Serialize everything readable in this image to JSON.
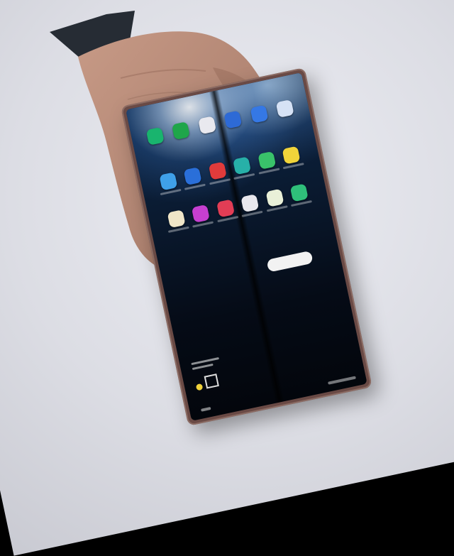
{
  "scene": {
    "background_color": "#dcdde4",
    "phone_frame_color": "#6a4a45"
  },
  "dock_icons": [
    {
      "name": "green-app-icon",
      "color": "#19b46e"
    },
    {
      "name": "green-app-icon-2",
      "color": "#1fa64a"
    },
    {
      "name": "gmail-icon",
      "color": "#e9e9ef"
    },
    {
      "name": "blue-app-icon",
      "color": "#2d6ad6"
    },
    {
      "name": "blue-app-icon-2",
      "color": "#3578e5"
    },
    {
      "name": "white-app-icon",
      "color": "#d6e2f5"
    }
  ],
  "home_icons": [
    {
      "name": "app-icon-1",
      "color": "#3fa0e8"
    },
    {
      "name": "app-icon-2",
      "color": "#2a6fd9"
    },
    {
      "name": "app-icon-3",
      "color": "#e03b3b"
    },
    {
      "name": "app-icon-4",
      "color": "#27b0a8"
    },
    {
      "name": "app-icon-5",
      "color": "#39c26a"
    },
    {
      "name": "app-icon-6",
      "color": "#f1d43a"
    },
    {
      "name": "app-icon-7",
      "color": "#f0e6c8"
    },
    {
      "name": "app-icon-8",
      "color": "#c63fd0"
    },
    {
      "name": "app-icon-9",
      "color": "#e23d55"
    },
    {
      "name": "app-icon-10",
      "color": "#e8e8ee"
    },
    {
      "name": "app-icon-11",
      "color": "#e9f0d8"
    },
    {
      "name": "app-icon-12",
      "color": "#2fbf7a"
    }
  ]
}
